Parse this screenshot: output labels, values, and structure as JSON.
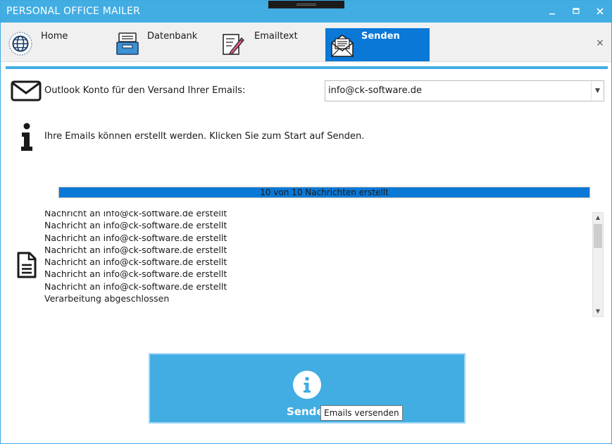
{
  "window": {
    "title": "PERSONAL OFFICE MAILER",
    "minimize_label": "🗕",
    "maximize_label": "🗖",
    "close_label": "✕"
  },
  "ribbon": {
    "tabs": [
      {
        "label": "Home",
        "icon": "globe-icon"
      },
      {
        "label": "Datenbank",
        "icon": "database-tray-icon"
      },
      {
        "label": "Emailtext",
        "icon": "edit-document-icon"
      },
      {
        "label": "Senden",
        "icon": "open-envelope-icon",
        "active": true
      }
    ],
    "close_label": "×"
  },
  "account": {
    "label": "Outlook Konto für den Versand Ihrer Emails:",
    "selected": "info@ck-software.de",
    "arrow": "▼"
  },
  "info": {
    "text": "Ihre Emails können erstellt werden. Klicken Sie zum Start auf Senden."
  },
  "progress": {
    "text": "10 von 10 Nachrichten erstellt",
    "fraction": 1.0
  },
  "log": {
    "lines": [
      "Nachricht an info@ck-software.de erstellt",
      "Nachricht an info@ck-software.de erstellt",
      "Nachricht an info@ck-software.de erstellt",
      "Nachricht an info@ck-software.de erstellt",
      "Nachricht an info@ck-software.de erstellt",
      "Nachricht an info@ck-software.de erstellt",
      "Nachricht an info@ck-software.de erstellt",
      "Verarbeitung abgeschlossen"
    ],
    "scroll_up": "▲",
    "scroll_down": "▼"
  },
  "send_button": {
    "label": "Sende",
    "tooltip": "Emails versenden"
  },
  "colors": {
    "accent": "#41ade3",
    "active_tab": "#0a78d7",
    "progress_fill": "#0a78d7"
  }
}
